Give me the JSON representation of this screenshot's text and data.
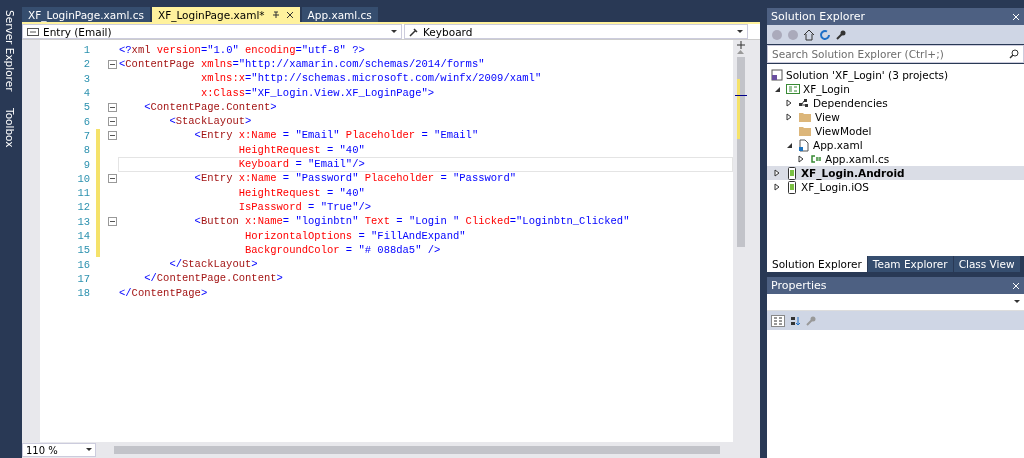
{
  "side_strip": [
    "Server Explorer",
    "Toolbox"
  ],
  "editor_tabs": [
    {
      "label": "XF_LoginPage.xaml.cs",
      "selected": false
    },
    {
      "label": "XF_LoginPage.xaml*",
      "selected": true
    },
    {
      "label": "App.xaml.cs",
      "selected": false
    }
  ],
  "navigation_bar": {
    "element": "Entry (Email)",
    "member": "Keyboard"
  },
  "code_lines": [
    {
      "number": "1",
      "fold": false,
      "changed": false,
      "current": false,
      "tokens": [
        {
          "kind": "delimiter",
          "text": "<?"
        },
        {
          "kind": "tag",
          "text": "xml"
        },
        {
          "kind": "attribute",
          "text": " version"
        },
        {
          "kind": "delimiter",
          "text": "="
        },
        {
          "kind": "value",
          "text": "\"1.0\""
        },
        {
          "kind": "attribute",
          "text": " encoding"
        },
        {
          "kind": "delimiter",
          "text": "="
        },
        {
          "kind": "value",
          "text": "\"utf-8\""
        },
        {
          "kind": "delimiter",
          "text": " ?>"
        }
      ]
    },
    {
      "number": "2",
      "fold": true,
      "changed": false,
      "current": false,
      "tokens": [
        {
          "kind": "delimiter",
          "text": "<"
        },
        {
          "kind": "tag",
          "text": "ContentPage"
        },
        {
          "kind": "attribute",
          "text": " xmlns"
        },
        {
          "kind": "delimiter",
          "text": "="
        },
        {
          "kind": "value",
          "text": "\"http://xamarin.com/schemas/2014/forms\""
        }
      ]
    },
    {
      "number": "3",
      "fold": false,
      "changed": false,
      "current": false,
      "tokens": [
        {
          "kind": "attribute",
          "text": "             xmlns:x"
        },
        {
          "kind": "delimiter",
          "text": "="
        },
        {
          "kind": "value",
          "text": "\"http://schemas.microsoft.com/winfx/2009/xaml\""
        }
      ]
    },
    {
      "number": "4",
      "fold": false,
      "changed": false,
      "current": false,
      "tokens": [
        {
          "kind": "attribute",
          "text": "             x:Class"
        },
        {
          "kind": "delimiter",
          "text": "="
        },
        {
          "kind": "value",
          "text": "\"XF_Login.View.XF_LoginPage\""
        },
        {
          "kind": "delimiter",
          "text": ">"
        }
      ]
    },
    {
      "number": "5",
      "fold": true,
      "changed": false,
      "current": false,
      "tokens": [
        {
          "kind": "delimiter",
          "text": "    <"
        },
        {
          "kind": "tag",
          "text": "ContentPage.Content"
        },
        {
          "kind": "delimiter",
          "text": ">"
        }
      ]
    },
    {
      "number": "6",
      "fold": true,
      "changed": false,
      "current": false,
      "tokens": [
        {
          "kind": "delimiter",
          "text": "        <"
        },
        {
          "kind": "tag",
          "text": "StackLayout"
        },
        {
          "kind": "delimiter",
          "text": ">"
        }
      ]
    },
    {
      "number": "7",
      "fold": true,
      "changed": true,
      "current": false,
      "tokens": [
        {
          "kind": "delimiter",
          "text": "            <"
        },
        {
          "kind": "tag",
          "text": "Entry"
        },
        {
          "kind": "attribute",
          "text": " x:Name"
        },
        {
          "kind": "delimiter",
          "text": " = "
        },
        {
          "kind": "value",
          "text": "\"Email\""
        },
        {
          "kind": "attribute",
          "text": " Placeholder"
        },
        {
          "kind": "delimiter",
          "text": " = "
        },
        {
          "kind": "value",
          "text": "\"Email\""
        }
      ]
    },
    {
      "number": "8",
      "fold": false,
      "changed": true,
      "current": false,
      "tokens": [
        {
          "kind": "attribute",
          "text": "                   HeightRequest"
        },
        {
          "kind": "delimiter",
          "text": " = "
        },
        {
          "kind": "value",
          "text": "\"40\""
        }
      ]
    },
    {
      "number": "9",
      "fold": false,
      "changed": true,
      "current": true,
      "tokens": [
        {
          "kind": "attribute",
          "text": "                   Keyboard"
        },
        {
          "kind": "delimiter",
          "text": " = "
        },
        {
          "kind": "value",
          "text": "\"Email\""
        },
        {
          "kind": "delimiter",
          "text": "/>"
        }
      ]
    },
    {
      "number": "10",
      "fold": true,
      "changed": true,
      "current": false,
      "tokens": [
        {
          "kind": "delimiter",
          "text": "            <"
        },
        {
          "kind": "tag",
          "text": "Entry"
        },
        {
          "kind": "attribute",
          "text": " x:Name"
        },
        {
          "kind": "delimiter",
          "text": " = "
        },
        {
          "kind": "value",
          "text": "\"Password\""
        },
        {
          "kind": "attribute",
          "text": " Placeholder"
        },
        {
          "kind": "delimiter",
          "text": " = "
        },
        {
          "kind": "value",
          "text": "\"Password\""
        }
      ]
    },
    {
      "number": "11",
      "fold": false,
      "changed": true,
      "current": false,
      "tokens": [
        {
          "kind": "attribute",
          "text": "                   HeightRequest"
        },
        {
          "kind": "delimiter",
          "text": " = "
        },
        {
          "kind": "value",
          "text": "\"40\""
        }
      ]
    },
    {
      "number": "12",
      "fold": false,
      "changed": true,
      "current": false,
      "tokens": [
        {
          "kind": "attribute",
          "text": "                   IsPassword"
        },
        {
          "kind": "delimiter",
          "text": " = "
        },
        {
          "kind": "value",
          "text": "\"True\""
        },
        {
          "kind": "delimiter",
          "text": "/>"
        }
      ]
    },
    {
      "number": "13",
      "fold": true,
      "changed": true,
      "current": false,
      "tokens": [
        {
          "kind": "delimiter",
          "text": "            <"
        },
        {
          "kind": "tag",
          "text": "Button"
        },
        {
          "kind": "attribute",
          "text": " x:Name"
        },
        {
          "kind": "delimiter",
          "text": "= "
        },
        {
          "kind": "value",
          "text": "\"loginbtn\""
        },
        {
          "kind": "attribute",
          "text": " Text"
        },
        {
          "kind": "delimiter",
          "text": " = "
        },
        {
          "kind": "value",
          "text": "\"Login \""
        },
        {
          "kind": "attribute",
          "text": " Clicked"
        },
        {
          "kind": "delimiter",
          "text": "="
        },
        {
          "kind": "value",
          "text": "\"Loginbtn_Clicked\""
        }
      ]
    },
    {
      "number": "14",
      "fold": false,
      "changed": true,
      "current": false,
      "tokens": [
        {
          "kind": "attribute",
          "text": "                    HorizontalOptions"
        },
        {
          "kind": "delimiter",
          "text": " = "
        },
        {
          "kind": "value",
          "text": "\"FillAndExpand\""
        }
      ]
    },
    {
      "number": "15",
      "fold": false,
      "changed": true,
      "current": false,
      "tokens": [
        {
          "kind": "attribute",
          "text": "                    BackgroundColor"
        },
        {
          "kind": "delimiter",
          "text": " = "
        },
        {
          "kind": "value",
          "text": "\"# 088da5\""
        },
        {
          "kind": "delimiter",
          "text": " />"
        }
      ]
    },
    {
      "number": "16",
      "fold": false,
      "changed": false,
      "current": false,
      "tokens": [
        {
          "kind": "delimiter",
          "text": "        </"
        },
        {
          "kind": "tag",
          "text": "StackLayout"
        },
        {
          "kind": "delimiter",
          "text": ">"
        }
      ]
    },
    {
      "number": "17",
      "fold": false,
      "changed": false,
      "current": false,
      "tokens": [
        {
          "kind": "delimiter",
          "text": "    </"
        },
        {
          "kind": "tag",
          "text": "ContentPage.Content"
        },
        {
          "kind": "delimiter",
          "text": ">"
        }
      ]
    },
    {
      "number": "18",
      "fold": false,
      "changed": false,
      "current": false,
      "tokens": [
        {
          "kind": "delimiter",
          "text": "</"
        },
        {
          "kind": "tag",
          "text": "ContentPage"
        },
        {
          "kind": "delimiter",
          "text": ">"
        }
      ]
    }
  ],
  "zoom": "110 %",
  "solution_explorer": {
    "title": "Solution Explorer",
    "search": {
      "placeholder": "Search Solution Explorer (Ctrl+;)"
    },
    "tree": [
      {
        "label": "Solution 'XF_Login' (3 projects)",
        "kind": "solution",
        "selected": false,
        "children": [
          {
            "label": "XF_Login",
            "kind": "csproj",
            "expanded": true,
            "selected": false,
            "children": [
              {
                "label": "Dependencies",
                "kind": "dependencies",
                "expanded": false,
                "selected": false
              },
              {
                "label": "View",
                "kind": "folder",
                "expanded": false,
                "selected": false
              },
              {
                "label": "ViewModel",
                "kind": "folder",
                "selected": false
              },
              {
                "label": "App.xaml",
                "kind": "xaml",
                "expanded": true,
                "selected": false,
                "children": [
                  {
                    "label": "App.xaml.cs",
                    "kind": "cs",
                    "expanded": false,
                    "selected": false
                  }
                ]
              }
            ]
          },
          {
            "label": "XF_Login.Android",
            "kind": "device",
            "expanded": false,
            "selected": true
          },
          {
            "label": "XF_Login.iOS",
            "kind": "device",
            "expanded": false,
            "selected": false
          }
        ]
      }
    ]
  },
  "panel_tabs": [
    {
      "label": "Solution Explorer",
      "selected": true
    },
    {
      "label": "Team Explorer",
      "selected": false
    },
    {
      "label": "Class View",
      "selected": false
    }
  ],
  "properties": {
    "title": "Properties"
  }
}
